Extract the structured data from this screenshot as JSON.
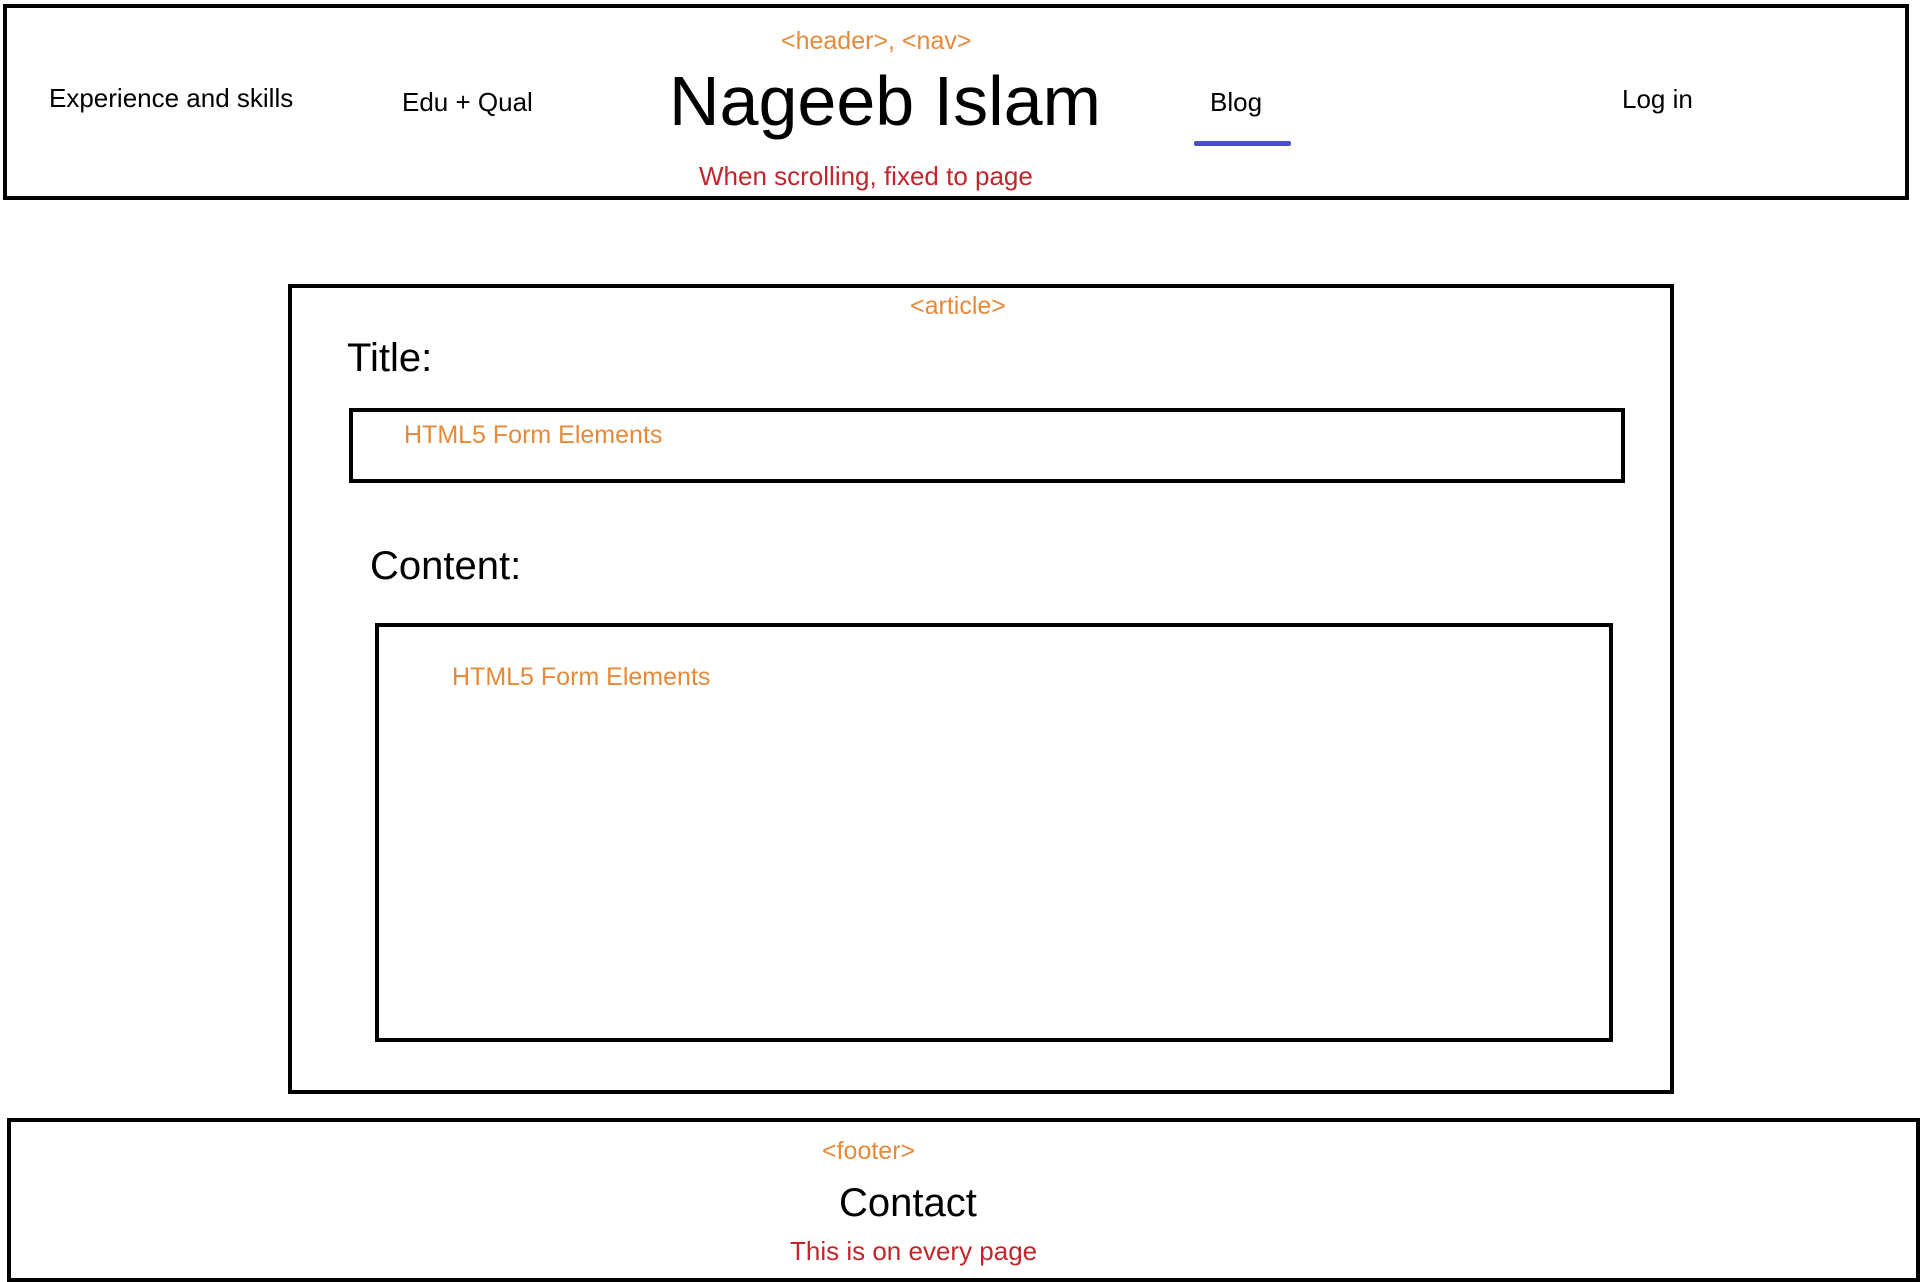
{
  "colors": {
    "annotation_tag": "#e6893a",
    "annotation_note": "#c0272d",
    "active_underline": "#4a4fc4",
    "border": "#000000",
    "text": "#000000"
  },
  "header": {
    "tag": "<header>, <nav>",
    "nav": {
      "experience": "Experience and skills",
      "edu": "Edu + Qual",
      "blog": "Blog",
      "login": "Log in"
    },
    "title": "Nageeb Islam",
    "note": "When scrolling, fixed to page",
    "active_item": "Blog"
  },
  "article": {
    "tag": "<article>",
    "title_label": "Title:",
    "title_field_text": "HTML5 Form Elements",
    "content_label": "Content:",
    "content_field_text": "HTML5 Form Elements"
  },
  "footer": {
    "tag": "<footer>",
    "contact": "Contact",
    "note": "This is on every page"
  }
}
